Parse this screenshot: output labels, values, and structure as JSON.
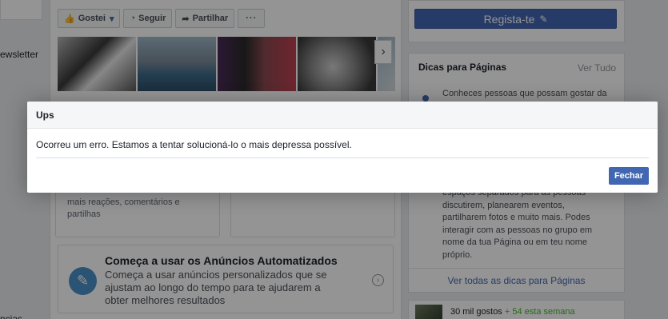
{
  "left": {
    "newsletter_link": "ewsletter",
    "bottom_link": "ncias"
  },
  "actions": {
    "like_label": "Gostei",
    "follow_label": "Seguir",
    "share_label": "Partilhar",
    "more_label": "···"
  },
  "cards": {
    "reactions_text": "mais reações, comentários e partilhas",
    "ads": {
      "title": "Começa a usar os Anúncios Automatizados",
      "description": "Começa a usar anúncios personalizados que se ajustam ao longo do tempo para te ajudarem a obter melhores resultados"
    }
  },
  "right": {
    "register_label": "Regista-te",
    "tips": {
      "title": "Dicas para Páginas",
      "see_all": "Ver Tudo",
      "line1": "Conheces pessoas que possam gostar da",
      "body": "espaços separados para as pessoas discutirem, planearem eventos, partilharem fotos e muito mais. Podes interagir com as pessoas no grupo em nome da tua Página ou em teu nome próprio.",
      "footer": "Ver todas as dicas para Páginas"
    },
    "likes": {
      "count": "30 mil gostos",
      "delta": "+ 54 esta semana"
    }
  },
  "dialog": {
    "title": "Ups",
    "message": "Ocorreu um erro. Estamos a tentar solucioná-lo o mais depressa possível.",
    "close_label": "Fechar"
  }
}
